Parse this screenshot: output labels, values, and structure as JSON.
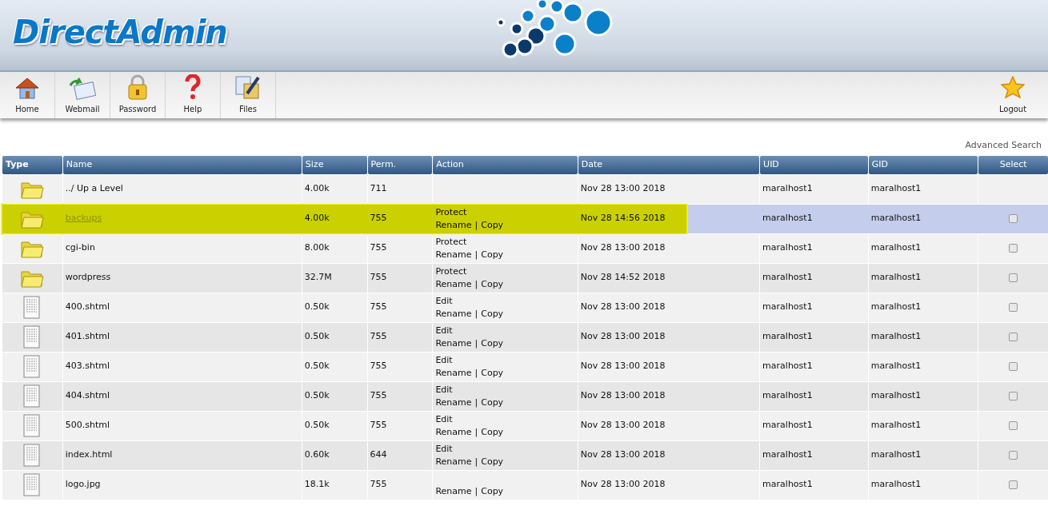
{
  "logo": {
    "text": "DirectAdmin"
  },
  "toolbar": [
    {
      "kind": "home",
      "label": "Home"
    },
    {
      "kind": "mail",
      "label": "Webmail"
    },
    {
      "kind": "lock",
      "label": "Password"
    },
    {
      "kind": "help",
      "label": "Help"
    },
    {
      "kind": "files",
      "label": "Files"
    }
  ],
  "logout": {
    "label": "Logout"
  },
  "advanced_search": "Advanced Search",
  "table": {
    "columns": [
      "Type",
      "Name",
      "Size",
      "Perm.",
      "Action",
      "Date",
      "UID",
      "GID",
      "Select"
    ],
    "rows": [
      {
        "kind": "folder",
        "name": "../ Up a Level",
        "size": "4.00k",
        "perm": "711",
        "date": "Nov 28 13:00 2018",
        "uid": "maralhost1",
        "gid": "maralhost1",
        "selected": false,
        "highlighted": false
      },
      {
        "kind": "folder",
        "name": "backups",
        "size": "4.00k",
        "perm": "755",
        "top_action": "Protect",
        "links": [
          "Rename",
          "Copy"
        ],
        "separator": "|",
        "date": "Nov 28 14:56 2018",
        "uid": "maralhost1",
        "gid": "maralhost1",
        "selected": true,
        "highlighted": true,
        "checked": false
      },
      {
        "kind": "folder",
        "name": "cgi-bin",
        "size": "8.00k",
        "perm": "755",
        "top_action": "Protect",
        "links": [
          "Rename",
          "Copy"
        ],
        "separator": "|",
        "date": "Nov 28 13:00 2018",
        "uid": "maralhost1",
        "gid": "maralhost1",
        "selected": false,
        "highlighted": false,
        "checked": false
      },
      {
        "kind": "folder",
        "name": "wordpress",
        "size": "32.7M",
        "perm": "755",
        "top_action": "Protect",
        "links": [
          "Rename",
          "Copy"
        ],
        "separator": "|",
        "date": "Nov 28 14:52 2018",
        "uid": "maralhost1",
        "gid": "maralhost1",
        "selected": false,
        "highlighted": false,
        "checked": false
      },
      {
        "kind": "file",
        "name": "400.shtml",
        "size": "0.50k",
        "perm": "755",
        "top_action": "Edit",
        "links": [
          "Rename",
          "Copy"
        ],
        "separator": "|",
        "date": "Nov 28 13:00 2018",
        "uid": "maralhost1",
        "gid": "maralhost1",
        "selected": false,
        "highlighted": false,
        "checked": false
      },
      {
        "kind": "file",
        "name": "401.shtml",
        "size": "0.50k",
        "perm": "755",
        "top_action": "Edit",
        "links": [
          "Rename",
          "Copy"
        ],
        "separator": "|",
        "date": "Nov 28 13:00 2018",
        "uid": "maralhost1",
        "gid": "maralhost1",
        "selected": false,
        "highlighted": false,
        "checked": false
      },
      {
        "kind": "file",
        "name": "403.shtml",
        "size": "0.50k",
        "perm": "755",
        "top_action": "Edit",
        "links": [
          "Rename",
          "Copy"
        ],
        "separator": "|",
        "date": "Nov 28 13:00 2018",
        "uid": "maralhost1",
        "gid": "maralhost1",
        "selected": false,
        "highlighted": false,
        "checked": false
      },
      {
        "kind": "file",
        "name": "404.shtml",
        "size": "0.50k",
        "perm": "755",
        "top_action": "Edit",
        "links": [
          "Rename",
          "Copy"
        ],
        "separator": "|",
        "date": "Nov 28 13:00 2018",
        "uid": "maralhost1",
        "gid": "maralhost1",
        "selected": false,
        "highlighted": false,
        "checked": false
      },
      {
        "kind": "file",
        "name": "500.shtml",
        "size": "0.50k",
        "perm": "755",
        "top_action": "Edit",
        "links": [
          "Rename",
          "Copy"
        ],
        "separator": "|",
        "date": "Nov 28 13:00 2018",
        "uid": "maralhost1",
        "gid": "maralhost1",
        "selected": false,
        "highlighted": false,
        "checked": false
      },
      {
        "kind": "file",
        "name": "index.html",
        "size": "0.60k",
        "perm": "644",
        "top_action": "Edit",
        "links": [
          "Rename",
          "Copy"
        ],
        "separator": "|",
        "date": "Nov 28 13:00 2018",
        "uid": "maralhost1",
        "gid": "maralhost1",
        "selected": false,
        "highlighted": false,
        "checked": false
      },
      {
        "kind": "file",
        "name": "logo.jpg",
        "size": "18.1k",
        "perm": "755",
        "links": [
          "Rename",
          "Copy"
        ],
        "separator": "|",
        "date": "Nov 28 13:00 2018",
        "uid": "maralhost1",
        "gid": "maralhost1",
        "selected": false,
        "highlighted": false,
        "checked": false
      }
    ]
  }
}
